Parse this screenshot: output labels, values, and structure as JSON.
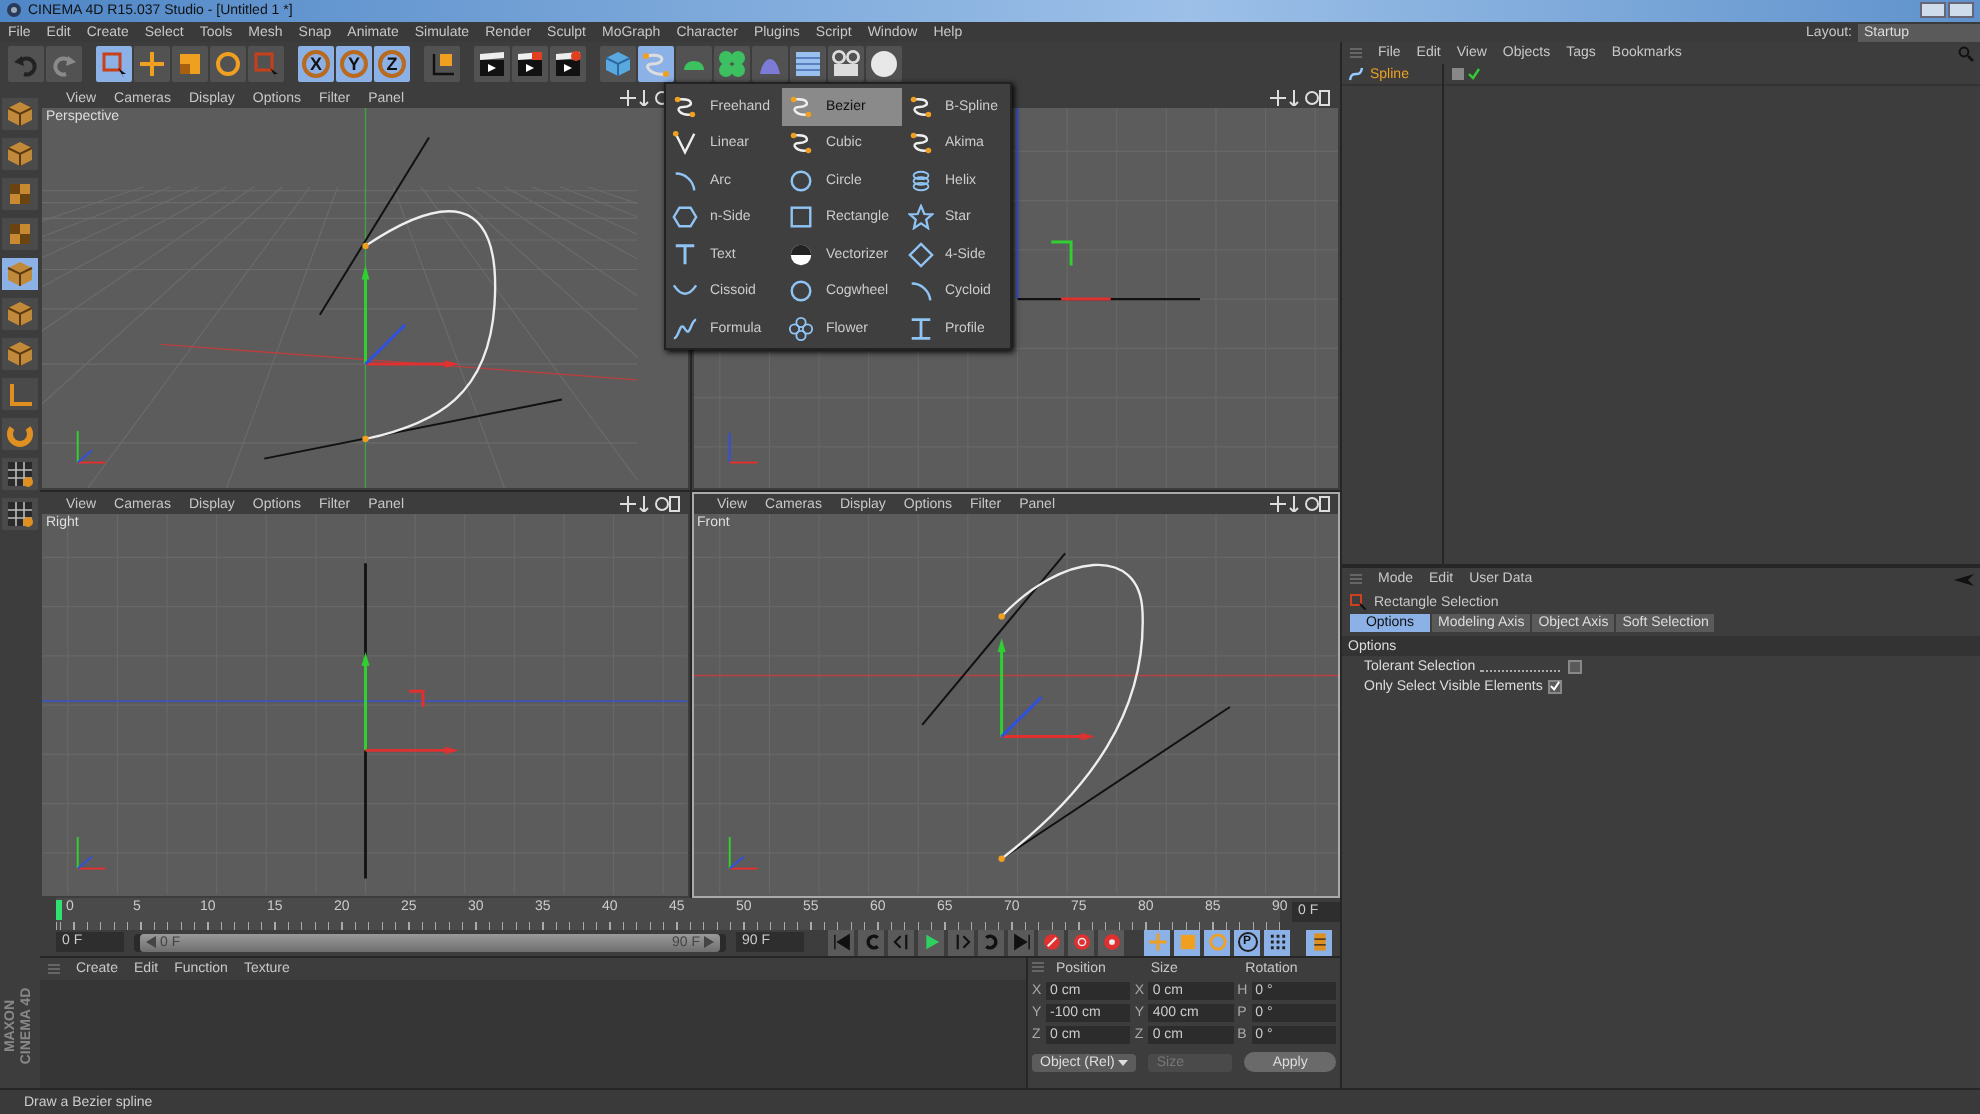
{
  "window": {
    "title": "CINEMA 4D R15.037 Studio - [Untitled 1 *]"
  },
  "menu_bar": [
    "File",
    "Edit",
    "Create",
    "Select",
    "Tools",
    "Mesh",
    "Snap",
    "Animate",
    "Simulate",
    "Render",
    "Sculpt",
    "MoGraph",
    "Character",
    "Plugins",
    "Script",
    "Window",
    "Help"
  ],
  "layout": {
    "label": "Layout:",
    "value": "Startup"
  },
  "toolbar": [
    {
      "kind": "undo",
      "active": false
    },
    {
      "kind": "redo",
      "active": false
    },
    {
      "kind": "live-select",
      "active": true
    },
    {
      "kind": "move",
      "active": false
    },
    {
      "kind": "scale",
      "active": false
    },
    {
      "kind": "rotate",
      "active": false
    },
    {
      "kind": "last-tool",
      "active": false
    },
    {
      "kind": "axis",
      "label": "X",
      "active": true
    },
    {
      "kind": "axis",
      "label": "Y",
      "active": true
    },
    {
      "kind": "axis",
      "label": "Z",
      "active": true
    },
    {
      "kind": "coords",
      "active": false
    },
    {
      "kind": "render-view",
      "active": false
    },
    {
      "kind": "render-picture",
      "active": false
    },
    {
      "kind": "render-settings",
      "active": false
    },
    {
      "kind": "cube",
      "active": false
    },
    {
      "kind": "spline",
      "active": true
    },
    {
      "kind": "generator",
      "active": false
    },
    {
      "kind": "array",
      "active": false
    },
    {
      "kind": "deformer",
      "active": false
    },
    {
      "kind": "scene",
      "active": false
    },
    {
      "kind": "camera",
      "active": false
    },
    {
      "kind": "light",
      "active": false
    }
  ],
  "side_tools": [
    {
      "kind": "model",
      "active": false
    },
    {
      "kind": "object",
      "active": false
    },
    {
      "kind": "texture-axis",
      "active": false
    },
    {
      "kind": "texture",
      "active": false
    },
    {
      "kind": "polygons",
      "active": true
    },
    {
      "kind": "edges",
      "active": false
    },
    {
      "kind": "points",
      "active": false
    },
    {
      "kind": "axis",
      "active": false
    },
    {
      "kind": "snap",
      "active": false
    },
    {
      "kind": "workplane",
      "active": false
    },
    {
      "kind": "grid",
      "active": false
    }
  ],
  "viewports": [
    {
      "kind": "perspective",
      "menu": [
        "View",
        "Cameras",
        "Display",
        "Options",
        "Filter",
        "Panel"
      ],
      "label": "Perspective",
      "active": false
    },
    {
      "kind": "top",
      "active": false
    },
    {
      "kind": "right",
      "menu": [
        "View",
        "Cameras",
        "Display",
        "Options",
        "Filter",
        "Panel"
      ],
      "label": "Right",
      "active": false
    },
    {
      "kind": "front",
      "menu": [
        "View",
        "Cameras",
        "Display",
        "Options",
        "Filter",
        "Panel"
      ],
      "label": "Front",
      "active": true
    }
  ],
  "spline_menu": [
    {
      "label": "Freehand",
      "selected": false
    },
    {
      "label": "Bezier",
      "selected": true
    },
    {
      "label": "B-Spline",
      "selected": false
    },
    {
      "label": "Linear",
      "selected": false
    },
    {
      "label": "Cubic",
      "selected": false
    },
    {
      "label": "Akima",
      "selected": false
    },
    {
      "label": "Arc",
      "selected": false
    },
    {
      "label": "Circle",
      "selected": false
    },
    {
      "label": "Helix",
      "selected": false
    },
    {
      "label": "n-Side",
      "selected": false
    },
    {
      "label": "Rectangle",
      "selected": false
    },
    {
      "label": "Star",
      "selected": false
    },
    {
      "label": "Text",
      "selected": false
    },
    {
      "label": "Vectorizer",
      "selected": false
    },
    {
      "label": "4-Side",
      "selected": false
    },
    {
      "label": "Cissoid",
      "selected": false
    },
    {
      "label": "Cogwheel",
      "selected": false
    },
    {
      "label": "Cycloid",
      "selected": false
    },
    {
      "label": "Formula",
      "selected": false
    },
    {
      "label": "Flower",
      "selected": false
    },
    {
      "label": "Profile",
      "selected": false
    }
  ],
  "timeline": {
    "ticks": [
      "0",
      "5",
      "10",
      "15",
      "20",
      "25",
      "30",
      "35",
      "40",
      "45",
      "50",
      "55",
      "60",
      "65",
      "70",
      "75",
      "80",
      "85",
      "90"
    ],
    "current_frame": "0 F",
    "start": "0 F",
    "range": {
      "start": "0 F",
      "end": "90 F",
      "level": 1
    },
    "end": "90 F"
  },
  "transport": [
    {
      "kind": "go-start"
    },
    {
      "kind": "prev-key"
    },
    {
      "kind": "prev-frame"
    },
    {
      "kind": "play"
    },
    {
      "kind": "next-frame"
    },
    {
      "kind": "next-key"
    },
    {
      "kind": "go-end"
    },
    {
      "kind": "record"
    },
    {
      "kind": "autokey"
    },
    {
      "kind": "keyset"
    }
  ],
  "key_tracks": [
    {
      "kind": "position",
      "active": true
    },
    {
      "kind": "scale",
      "active": true
    },
    {
      "kind": "rotation",
      "active": true
    },
    {
      "kind": "parameter",
      "label": "P",
      "active": true
    },
    {
      "kind": "points",
      "active": true
    }
  ],
  "material_manager": {
    "menu": [
      "Create",
      "Edit",
      "Function",
      "Texture"
    ]
  },
  "logo": [
    "MAXON",
    "CINEMA 4D"
  ],
  "coordinates": {
    "headers": [
      "Position",
      "Size",
      "Rotation"
    ],
    "rows": [
      [
        {
          "axis": "X",
          "value": "0 cm"
        },
        {
          "axis": "X",
          "value": "0 cm"
        },
        {
          "axis": "H",
          "value": "0 °"
        }
      ],
      [
        {
          "axis": "Y",
          "value": "-100 cm"
        },
        {
          "axis": "Y",
          "value": "400 cm"
        },
        {
          "axis": "P",
          "value": "0 °"
        }
      ],
      [
        {
          "axis": "Z",
          "value": "0 cm"
        },
        {
          "axis": "Z",
          "value": "0 cm"
        },
        {
          "axis": "B",
          "value": "0 °"
        }
      ]
    ],
    "mode": "Object (Rel)",
    "size_mode": "Size",
    "apply": "Apply"
  },
  "object_manager": {
    "menu": [
      "File",
      "Edit",
      "View",
      "Objects",
      "Tags",
      "Bookmarks"
    ],
    "objects": [
      {
        "name": "Spline",
        "selected": true
      }
    ]
  },
  "attributes": {
    "menu": [
      "Mode",
      "Edit",
      "User Data"
    ],
    "tool": "Rectangle Selection",
    "tabs": [
      {
        "label": "Options",
        "selected": true
      },
      {
        "label": "Modeling Axis",
        "selected": false
      },
      {
        "label": "Object Axis",
        "selected": false
      },
      {
        "label": "Soft Selection",
        "selected": false
      }
    ],
    "section": "Options",
    "options": [
      {
        "label": "Tolerant Selection",
        "checked": false,
        "leader": true
      },
      {
        "label": "Only Select Visible Elements",
        "checked": true,
        "leader": false
      }
    ]
  },
  "status_bar": "Draw a Bezier spline"
}
